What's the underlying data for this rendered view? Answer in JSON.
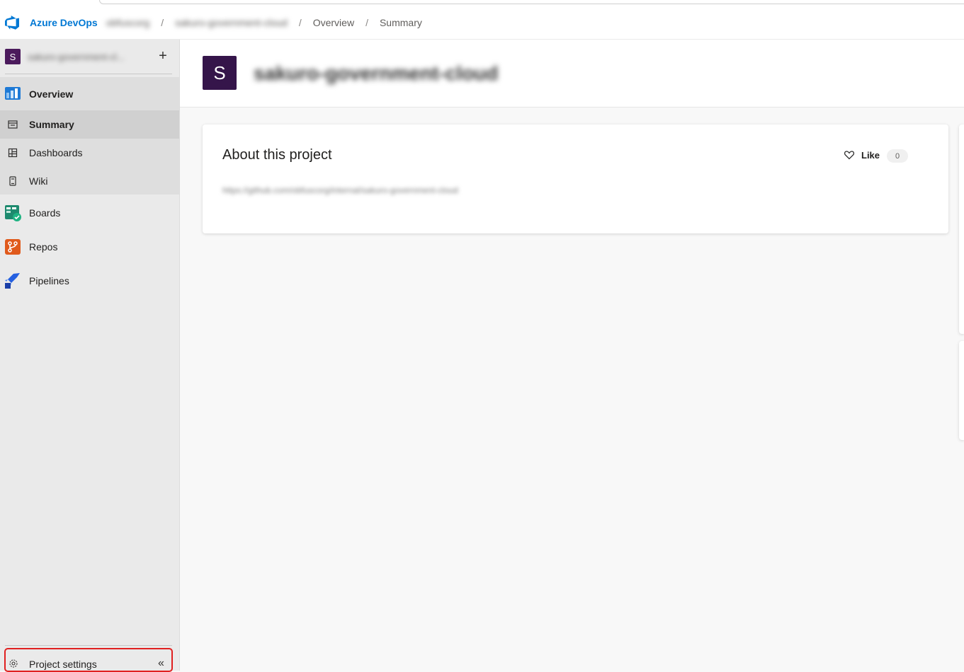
{
  "header": {
    "brand": "Azure DevOps",
    "org": "obfuscorg",
    "project": "sakuro-government-cloud",
    "breadcrumbs": [
      "Overview",
      "Summary"
    ],
    "separator": "/"
  },
  "sidebar": {
    "project_initial": "S",
    "project_name": "sakuro-government-cl...",
    "add_label": "+",
    "overview": {
      "label": "Overview",
      "items": [
        {
          "label": "Summary",
          "icon": "summary-icon",
          "selected": true
        },
        {
          "label": "Dashboards",
          "icon": "dashboards-icon"
        },
        {
          "label": "Wiki",
          "icon": "wiki-icon"
        }
      ]
    },
    "sections": [
      {
        "label": "Boards",
        "icon": "boards-icon",
        "color": "#009ccc"
      },
      {
        "label": "Repos",
        "icon": "repos-icon",
        "color": "#e05a1c"
      },
      {
        "label": "Pipelines",
        "icon": "pipelines-icon",
        "color": "#2560e0"
      }
    ],
    "settings_label": "Project settings",
    "collapse_label": "«"
  },
  "main": {
    "avatar_initial": "S",
    "title": "sakuro-government-cloud",
    "about": {
      "title": "About this project",
      "like_label": "Like",
      "like_count": "0",
      "url": "https://github.com/obfuscorg/internal/sakuro-government-cloud"
    }
  },
  "colors": {
    "accent": "#0078d4",
    "project_avatar": "#35154a",
    "highlight_border": "#e02020"
  }
}
